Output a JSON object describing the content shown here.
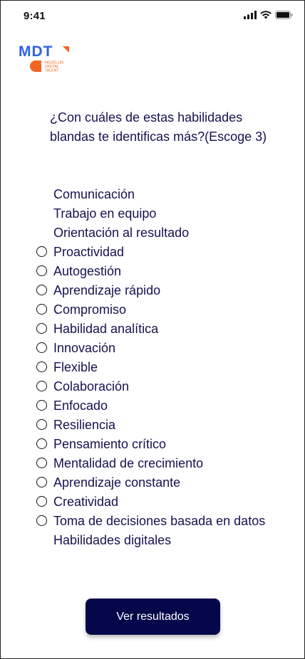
{
  "status_bar": {
    "time": "9:41",
    "icons": [
      "signal-icon",
      "wifi-icon",
      "battery-icon"
    ]
  },
  "logo": {
    "wordmark": "MDT",
    "tagline_lines": [
      "MEDELLÍN",
      "DIGITAL",
      "TALENT"
    ],
    "brand_blue": "#2f63e6",
    "brand_orange": "#f26522"
  },
  "question": {
    "text": "¿Con cuáles de estas habilidades blandas te identificas más?(Escoge 3)"
  },
  "options": [
    {
      "label": "Comunicación",
      "radio": false
    },
    {
      "label": "Trabajo en equipo",
      "radio": false
    },
    {
      "label": "Orientación al resultado",
      "radio": false
    },
    {
      "label": "Proactividad",
      "radio": true
    },
    {
      "label": "Autogestión",
      "radio": true
    },
    {
      "label": "Aprendizaje rápido",
      "radio": true
    },
    {
      "label": "Compromiso",
      "radio": true
    },
    {
      "label": "Habilidad analítica",
      "radio": true
    },
    {
      "label": "Innovación",
      "radio": true
    },
    {
      "label": "Flexible",
      "radio": true
    },
    {
      "label": "Colaboración",
      "radio": true
    },
    {
      "label": "Enfocado",
      "radio": true
    },
    {
      "label": "Resiliencia",
      "radio": true
    },
    {
      "label": "Pensamiento crítico",
      "radio": true
    },
    {
      "label": "Mentalidad de crecimiento",
      "radio": true
    },
    {
      "label": "Aprendizaje constante",
      "radio": true
    },
    {
      "label": "Creatividad",
      "radio": true
    },
    {
      "label": "Toma de decisiones basada en datos",
      "radio": true
    },
    {
      "label": "Habilidades digitales",
      "radio": false
    }
  ],
  "cta": {
    "label": "Ver resultados"
  },
  "colors": {
    "text": "#14124f",
    "button_bg": "#05074a",
    "button_text": "#ffffff"
  }
}
